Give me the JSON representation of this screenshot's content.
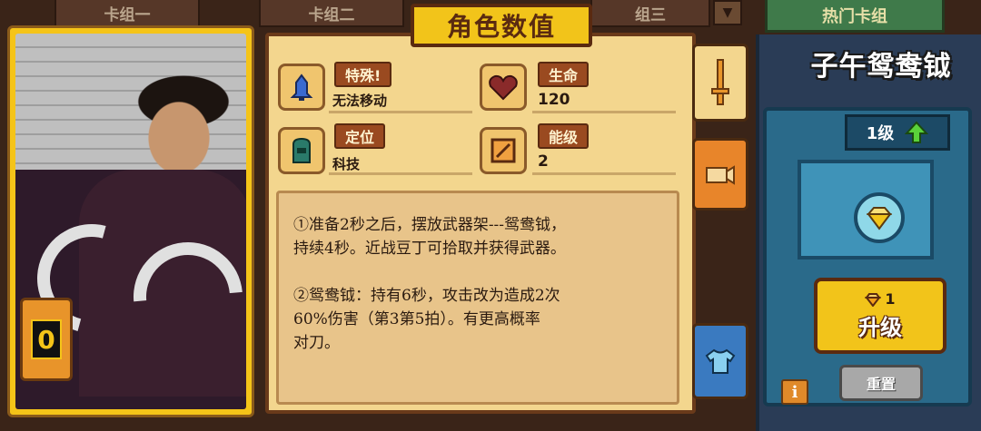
{
  "deck_tabs": [
    "卡组一",
    "卡组二",
    "组三"
  ],
  "hot_deck_label": "热门卡组",
  "panel_title": "角色数值",
  "stats": {
    "special": {
      "label": "特殊!",
      "value": "无法移动"
    },
    "health": {
      "label": "生命",
      "value": "120"
    },
    "position": {
      "label": "定位",
      "value": "科技"
    },
    "energy_level": {
      "label": "能级",
      "value": "2"
    }
  },
  "description": {
    "p1": "①准备2秒之后，摆放武器架---鸳鸯钺，\n持续4秒。近战豆丁可拾取并获得武器。",
    "p2": "②鸳鸯钺：持有6秒，攻击改为造成2次\n60%伤害（第3第5拍）。有更高概率\n对刀。"
  },
  "card": {
    "cost": "0"
  },
  "weapon": {
    "name": "子午鸳鸯钺",
    "level": "1级",
    "upgrade_cost": "1",
    "upgrade_label": "升级",
    "reset_label": "重置"
  },
  "colors": {
    "panel_bg": "#f3d68e",
    "title_bg": "#f2c41a",
    "label_bg": "#9a4a20",
    "right_panel": "#2a3c56",
    "level_arrow": "#5ad23a"
  }
}
